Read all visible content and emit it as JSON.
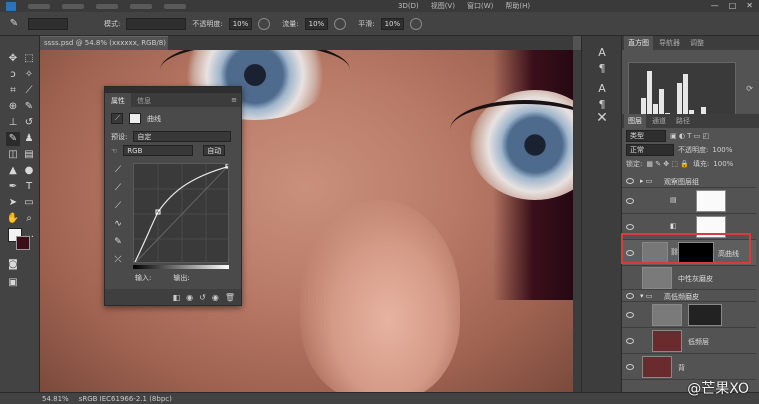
{
  "menubar": {
    "items": [
      "3D(D)",
      "视图(V)",
      "窗口(W)",
      "帮助(H)"
    ],
    "window_controls": [
      "—",
      "□",
      "✕"
    ]
  },
  "options": {
    "mode_label": "模式:",
    "opacity_label": "不透明度:",
    "opacity_value": "10%",
    "flow_label": "流量:",
    "flow_value": "10%",
    "smooth_label": "平滑:",
    "smooth_value": "10%"
  },
  "document": {
    "tab_title": "ssss.psd @ 54.8% (xxxxxx, RGB/8)"
  },
  "properties_panel": {
    "tabs": [
      "属性",
      "信息"
    ],
    "adjustment_name": "曲线",
    "preset_label": "预设:",
    "preset_value": "自定",
    "channel_value": "RGB",
    "auto_button": "自动",
    "input_label": "输入:",
    "output_label": "输出:"
  },
  "right_panel": {
    "top_tabs": [
      "直方图",
      "导航器",
      "调整"
    ],
    "layer_tabs": [
      "图层",
      "通道",
      "路径"
    ],
    "kind_label": "类型",
    "blend_mode": "正常",
    "opacity_label": "不透明度:",
    "opacity_value": "100%",
    "lock_label": "锁定:",
    "fill_label": "填充:",
    "fill_value": "100%",
    "layers": [
      {
        "name": "观察图层组",
        "type": "group"
      },
      {
        "name": "",
        "type": "adjustment"
      },
      {
        "name": "",
        "type": "adjustment"
      },
      {
        "name": "高曲线",
        "type": "adjustment",
        "selected": true
      },
      {
        "name": "中性灰磨皮",
        "type": "pixel"
      },
      {
        "name": "高低频磨皮",
        "type": "group"
      },
      {
        "name": "",
        "type": "pixel"
      },
      {
        "name": "低频层",
        "type": "pixel"
      },
      {
        "name": "背",
        "type": "pixel"
      }
    ]
  },
  "histogram": {
    "bars": [
      0.05,
      0.1,
      0.45,
      0.9,
      0.35,
      0.6,
      0.2,
      0.15,
      0.7,
      0.85,
      0.25,
      0.12,
      0.3,
      0.1,
      0.06,
      0.04,
      0.03,
      0.02
    ]
  },
  "status": {
    "zoom": "54.81%",
    "profile": "sRGB IEC61966-2.1 (8bpc)"
  },
  "watermark": "@芒果XO"
}
